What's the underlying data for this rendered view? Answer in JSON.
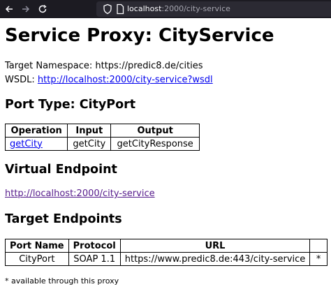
{
  "browser": {
    "url_host": "localhost",
    "url_path": ":2000/city-service"
  },
  "page": {
    "title": "Service Proxy: CityService",
    "namespace_label": "Target Namespace:",
    "namespace_value": "https://predic8.de/cities",
    "wsdl_label": "WSDL:",
    "wsdl_link": "http://localhost:2000/city-service?wsdl",
    "port_type_heading": "Port Type: CityPort",
    "operations_table": {
      "headers": [
        "Operation",
        "Input",
        "Output"
      ],
      "rows": [
        {
          "operation": "getCity",
          "input": "getCity",
          "output": "getCityResponse"
        }
      ]
    },
    "virtual_endpoint_heading": "Virtual Endpoint",
    "virtual_endpoint_link": "http://localhost:2000/city-service",
    "target_endpoints_heading": "Target Endpoints",
    "endpoints_table": {
      "headers": [
        "Port Name",
        "Protocol",
        "URL",
        ""
      ],
      "rows": [
        {
          "port_name": "CityPort",
          "protocol": "SOAP 1.1",
          "url": "https://www.predic8.de:443/city-service",
          "marker": "*"
        }
      ]
    },
    "footnote": "* available through this proxy"
  }
}
